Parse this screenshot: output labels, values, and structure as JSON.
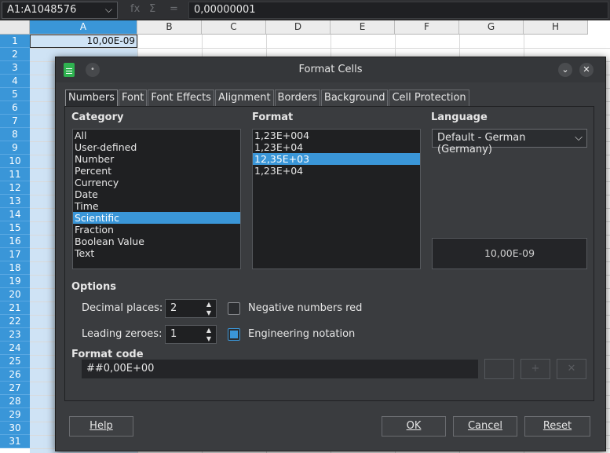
{
  "formula_bar": {
    "name_box": "A1:A1048576",
    "function_wizard_icon": "fx",
    "sum_icon": "Σ",
    "equals_icon": "=",
    "formula_value": "0,00000001"
  },
  "sheet": {
    "columns": [
      "A",
      "B",
      "C",
      "D",
      "E",
      "F",
      "G",
      "H"
    ],
    "rows": [
      "1",
      "2",
      "3",
      "4",
      "5",
      "6",
      "7",
      "8",
      "9",
      "10",
      "11",
      "12",
      "13",
      "14",
      "15",
      "16",
      "17",
      "18",
      "19",
      "20",
      "21",
      "22",
      "23",
      "24",
      "25",
      "26",
      "27",
      "28",
      "29",
      "30",
      "31"
    ],
    "cell_a1": "10,00E-09"
  },
  "dialog": {
    "title": "Format Cells",
    "tabs": [
      "Numbers",
      "Font",
      "Font Effects",
      "Alignment",
      "Borders",
      "Background",
      "Cell Protection"
    ],
    "category": {
      "label": "Category",
      "items": [
        "All",
        "User-defined",
        "Number",
        "Percent",
        "Currency",
        "Date",
        "Time",
        "Scientific",
        "Fraction",
        "Boolean Value",
        "Text"
      ],
      "selected": "Scientific"
    },
    "format": {
      "label": "Format",
      "items": [
        "1,23E+004",
        "1,23E+04",
        "12,35E+03",
        "1,23E+04"
      ],
      "selected_index": 2
    },
    "language": {
      "label": "Language",
      "value": "Default - German (Germany)"
    },
    "preview": "10,00E-09",
    "options": {
      "label": "Options",
      "decimal_places_label": "Decimal places:",
      "decimal_places": "2",
      "leading_zeroes_label": "Leading zeroes:",
      "leading_zeroes": "1",
      "negative_red_label": "Negative numbers red",
      "negative_red_checked": false,
      "engineering_label": "Engineering notation",
      "engineering_checked": true
    },
    "format_code": {
      "label": "Format code",
      "value": "##0,00E+00"
    },
    "buttons": {
      "help": "Help",
      "ok": "OK",
      "cancel": "Cancel",
      "reset": "Reset"
    },
    "colors": {
      "selection": "#3a96d8",
      "dialog_bg": "#3a3c3f",
      "list_bg": "#1f2022"
    }
  }
}
